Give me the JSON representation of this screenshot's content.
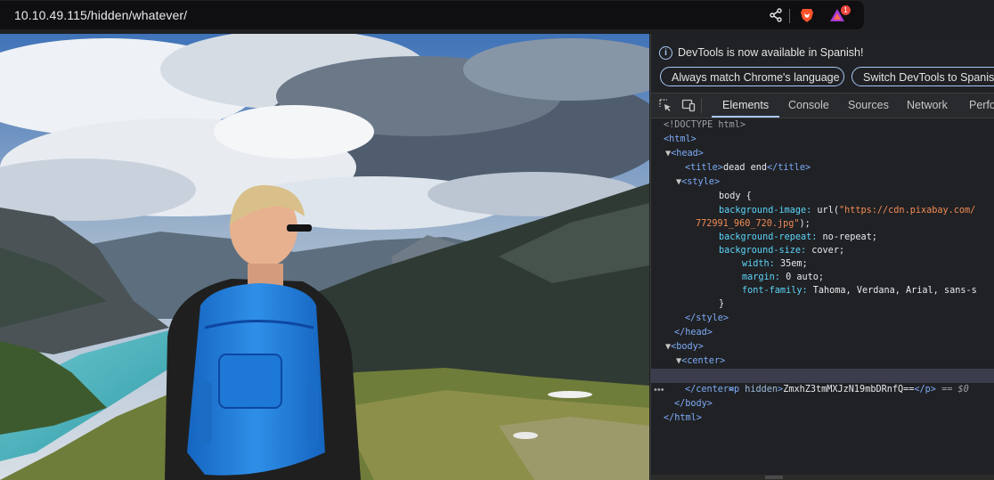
{
  "address_bar": {
    "url": "10.10.49.115/hidden/whatever/"
  },
  "extensions": {
    "badge_count": "1"
  },
  "devtools": {
    "info_message": "DevTools is now available in Spanish!",
    "button_match_language": "Always match Chrome's language",
    "button_switch_spanish": "Switch DevTools to Spanish",
    "tabs": [
      "Elements",
      "Console",
      "Sources",
      "Network",
      "Perfo"
    ],
    "active_tab": "Elements",
    "dom": {
      "doctype": "<!DOCTYPE html>",
      "html_open": "<html>",
      "head_open": "<head>",
      "title_open": "<title>",
      "title_text": "dead end",
      "title_close": "</title>",
      "style_open": "<style>",
      "css_body_selector": "body {",
      "css_bg_image_prop": "background-image:",
      "css_bg_image_fn": "url(",
      "css_bg_image_url_1": "\"https://cdn.pixabay.com/",
      "css_bg_image_url_2": "772991_960_720.jpg\"",
      "css_bg_image_end": ");",
      "css_bg_repeat_prop": "background-repeat:",
      "css_bg_repeat_val": "no-repeat;",
      "css_bg_size_prop": "background-size:",
      "css_bg_size_val": "cover;",
      "css_width_prop": "width:",
      "css_width_val": "35em;",
      "css_margin_prop": "margin:",
      "css_margin_val": "0 auto;",
      "css_font_prop": "font-family:",
      "css_font_val": "Tahoma, Verdana, Arial, sans-s",
      "css_close_brace": "}",
      "style_close": "</style>",
      "head_close": "</head>",
      "body_open": "<body>",
      "center_open": "<center>",
      "p_open_start": "<p",
      "p_attr": "hidden",
      "p_open_end": ">",
      "p_text": "ZmxhZ3tmMXJzN19mbDRnfQ==",
      "p_close": "</p>",
      "p_selected_marker": "== $0",
      "center_close": "</center>",
      "body_close": "</body>",
      "html_close": "</html>"
    }
  },
  "colors": {
    "devtools_bg": "#202124",
    "tag_blue": "#7cacf8",
    "css_property": "#5cd5fb",
    "string_orange": "#f28b54",
    "selection": "#3c3d4c"
  },
  "icons": [
    "share-icon",
    "brave-lion-icon",
    "brave-rewards-triangle-icon",
    "info-icon",
    "inspect-element-icon",
    "device-toolbar-icon"
  ]
}
